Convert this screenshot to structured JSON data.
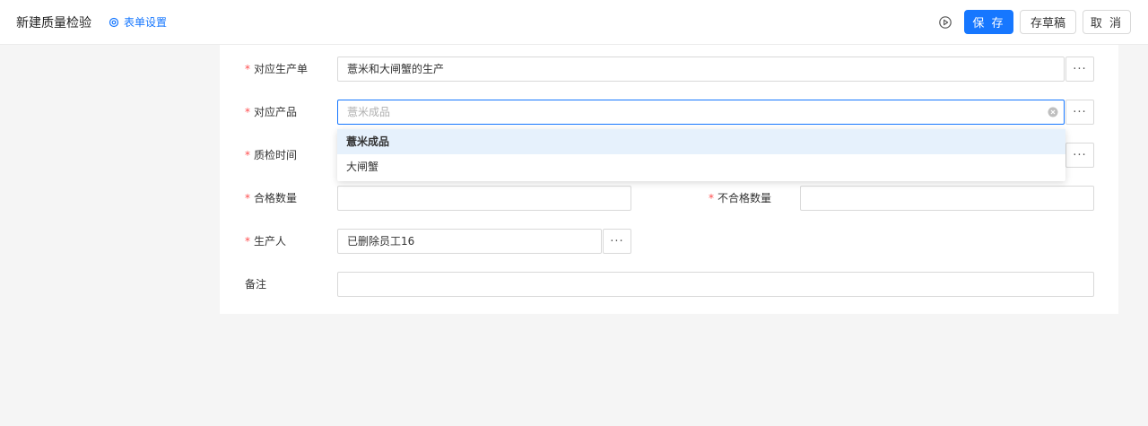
{
  "header": {
    "title": "新建质量检验",
    "settings_label": "表单设置",
    "save_label": "保 存",
    "draft_label": "存草稿",
    "cancel_label": "取 消"
  },
  "colors": {
    "primary": "#1677ff",
    "required": "#ff4d4f",
    "selected_option_bg": "#e6f1fc"
  },
  "form": {
    "required_mark": "*",
    "production_order": {
      "label": "对应生产单",
      "value": "薏米和大闸蟹的生产"
    },
    "product": {
      "label": "对应产品",
      "placeholder": "薏米成品"
    },
    "inspect_time": {
      "label": "质检时间"
    },
    "qualified_qty": {
      "label": "合格数量"
    },
    "unqualified_qty": {
      "label": "不合格数量"
    },
    "producer": {
      "label": "生产人",
      "value": "已删除员工16"
    },
    "remark": {
      "label": "备注"
    },
    "more_label": "···"
  },
  "dropdown": {
    "options": [
      "薏米成品",
      "大闸蟹"
    ],
    "selected_index": 0
  },
  "icons": {
    "settings": "gear-icon",
    "preview": "play-circle-icon",
    "clear": "clear-circle-icon"
  }
}
